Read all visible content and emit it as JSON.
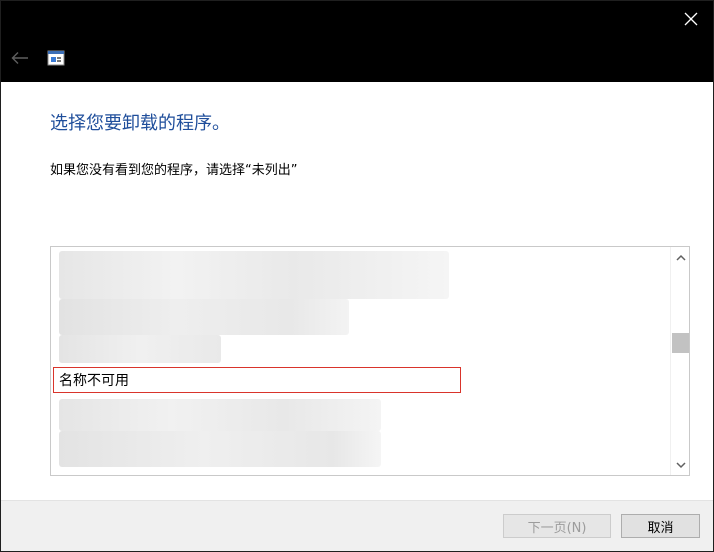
{
  "titlebar": {
    "icons": {
      "close": "close-icon",
      "back": "back-arrow-icon",
      "app": "app-icon"
    }
  },
  "content": {
    "heading": "选择您要卸载的程序。",
    "subtext": "如果您没有看到您的程序，请选择“未列出”"
  },
  "list": {
    "selected_item": "名称不可用",
    "blurred": true
  },
  "buttons": {
    "next_label": "下一页(N)",
    "cancel_label": "取消"
  },
  "colors": {
    "titlebar": "#000000",
    "heading": "#1f4e9b",
    "selection_border": "#d9342b",
    "footer": "#f0f0f0"
  }
}
